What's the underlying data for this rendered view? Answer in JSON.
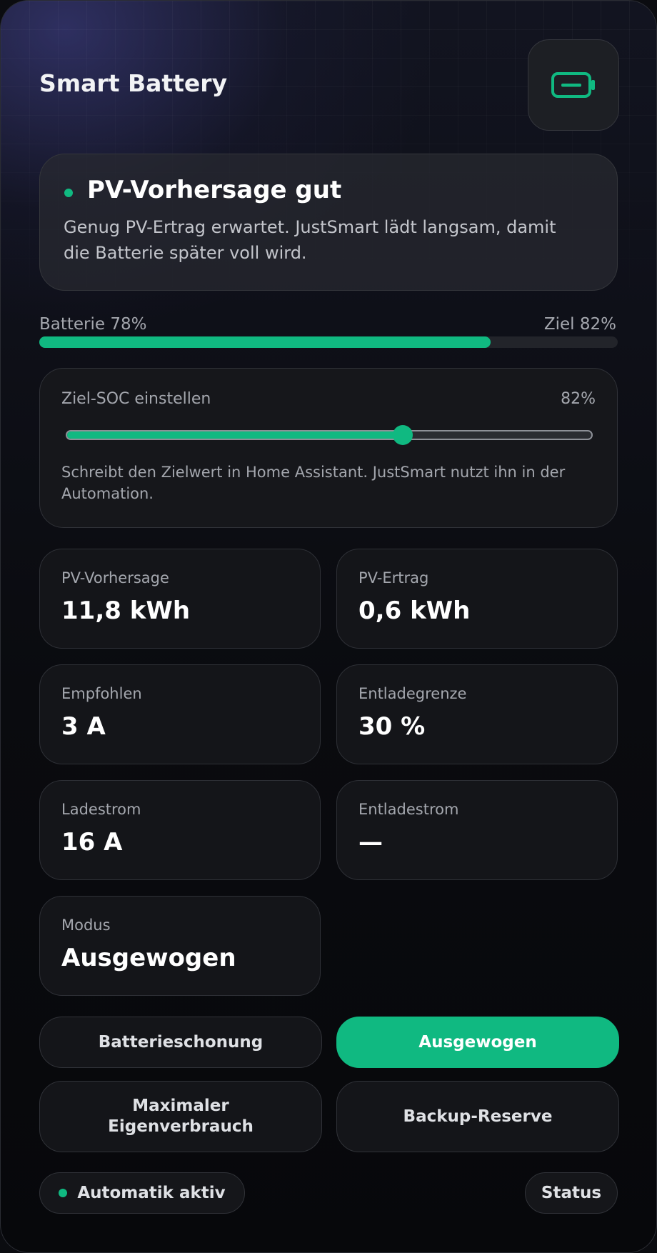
{
  "header": {
    "title": "Smart Battery",
    "icon": "battery-icon"
  },
  "colors": {
    "accent": "#10b981",
    "background": "#0b0c10",
    "card": "#141519"
  },
  "forecast": {
    "title": "PV-Vorhersage gut",
    "text": "Genug PV-Ertrag erwartet. JustSmart lädt langsam, damit die Batterie später voll wird."
  },
  "battery": {
    "label": "Batterie 78%",
    "target_label": "Ziel 82%",
    "level": 0.78,
    "target": 0.82
  },
  "soc": {
    "label": "Ziel-SOC einstellen",
    "value_text": "82%",
    "slider_position": 0.64,
    "note": "Schreibt den Zielwert in Home Assistant. JustSmart nutzt ihn in der Automation."
  },
  "stats": [
    {
      "label": "PV-Vorhersage",
      "value": "11,8 kWh"
    },
    {
      "label": "PV-Ertrag",
      "value": "0,6 kWh"
    },
    {
      "label": "Empfohlen",
      "value": "3 A"
    },
    {
      "label": "Entladegrenze",
      "value": "30 %"
    },
    {
      "label": "Ladestrom",
      "value": "16 A"
    },
    {
      "label": "Entladestrom",
      "value": "—"
    },
    {
      "label": "Modus",
      "value": "Ausgewogen"
    }
  ],
  "modes": [
    {
      "label": "Batterieschonung",
      "active": false
    },
    {
      "label": "Ausgewogen",
      "active": true
    },
    {
      "label": "Maximaler Eigenverbrauch",
      "active": false
    },
    {
      "label": "Backup-Reserve",
      "active": false
    }
  ],
  "footer": {
    "automation_label": "Automatik aktiv",
    "status_label": "Status"
  }
}
